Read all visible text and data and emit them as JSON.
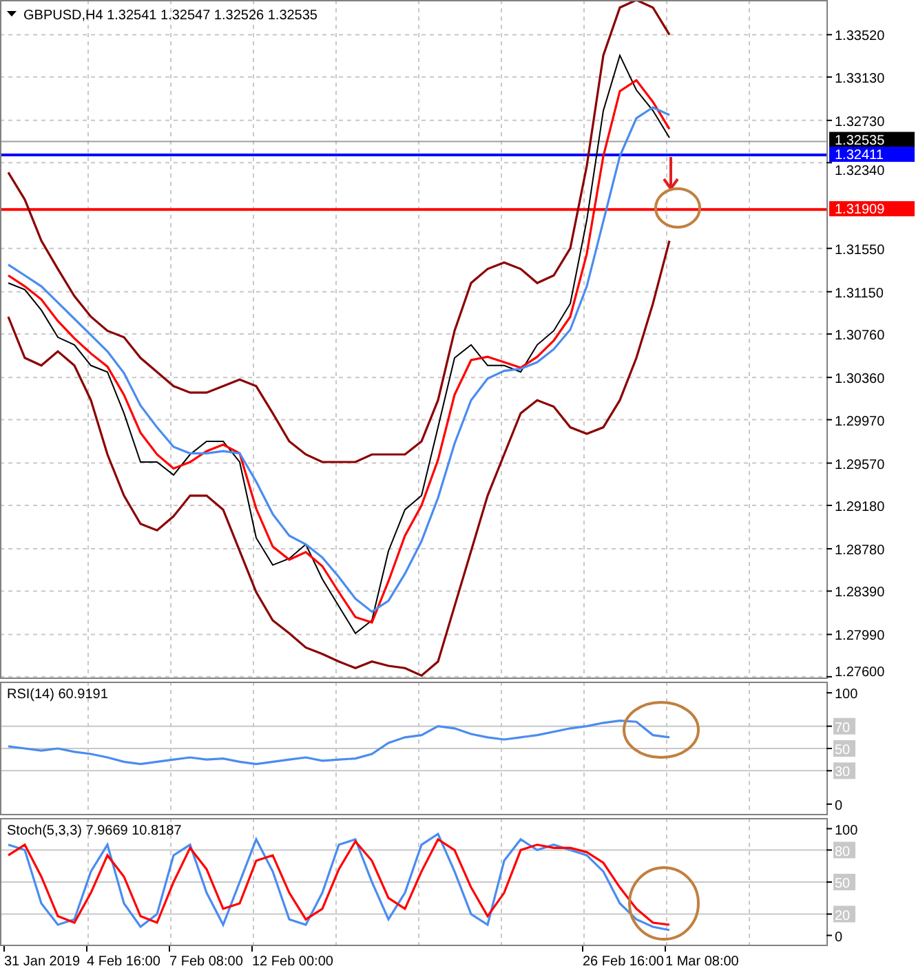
{
  "price_chart": {
    "chart_data": {
      "type": "line",
      "title": "GBPUSD,H4 1.32541 1.32547 1.32526 1.32535",
      "grid": true,
      "ylim": [
        1.2758,
        1.3384
      ],
      "yticks": [
        {
          "value": 1.3352,
          "label": "1.33520"
        },
        {
          "value": 1.3313,
          "label": "1.33130"
        },
        {
          "value": 1.3273,
          "label": "1.32730"
        },
        {
          "value": 1.3234,
          "label": "1.32340"
        },
        {
          "value": 1.3155,
          "label": "1.31550"
        },
        {
          "value": 1.3115,
          "label": "1.31150"
        },
        {
          "value": 1.3076,
          "label": "1.30760"
        },
        {
          "value": 1.3036,
          "label": "1.30360"
        },
        {
          "value": 1.2997,
          "label": "1.29970"
        },
        {
          "value": 1.2957,
          "label": "1.29570"
        },
        {
          "value": 1.2918,
          "label": "1.29180"
        },
        {
          "value": 1.2878,
          "label": "1.28780"
        },
        {
          "value": 1.2839,
          "label": "1.28390"
        },
        {
          "value": 1.2799,
          "label": "1.27990"
        },
        {
          "value": 1.276,
          "label": "1.27600"
        }
      ],
      "series": [
        {
          "color": "#000000",
          "values": [
            1.3123,
            1.3117,
            1.3098,
            1.3073,
            1.3066,
            1.3047,
            1.3041,
            1.3003,
            1.2958,
            1.2958,
            1.2946,
            1.2965,
            1.2977,
            1.2977,
            1.2958,
            1.2888,
            1.2863,
            1.2869,
            1.2882,
            1.285,
            1.2825,
            1.28,
            1.2812,
            1.2876,
            1.2914,
            1.2927,
            1.299,
            1.3054,
            1.3066,
            1.3047,
            1.3047,
            1.3041,
            1.3066,
            1.3079,
            1.3104,
            1.3181,
            1.3282,
            1.3333,
            1.3301,
            1.3282,
            1.3257
          ]
        },
        {
          "color": "#ff0000",
          "values": [
            1.313,
            1.312,
            1.3108,
            1.3088,
            1.3072,
            1.3058,
            1.3046,
            1.302,
            1.2985,
            1.2965,
            1.2952,
            1.2958,
            1.2968,
            1.2974,
            1.2966,
            1.2915,
            1.288,
            1.2868,
            1.2875,
            1.2862,
            1.2838,
            1.2815,
            1.281,
            1.2848,
            1.289,
            1.2918,
            1.296,
            1.302,
            1.3052,
            1.3055,
            1.305,
            1.3045,
            1.3055,
            1.307,
            1.3092,
            1.315,
            1.324,
            1.33,
            1.331,
            1.329,
            1.3265
          ]
        },
        {
          "color": "#4a8cf0",
          "values": [
            1.314,
            1.313,
            1.312,
            1.3105,
            1.309,
            1.3075,
            1.306,
            1.304,
            1.301,
            1.299,
            1.2972,
            1.2966,
            1.2966,
            1.2968,
            1.2966,
            1.294,
            1.291,
            1.289,
            1.2882,
            1.287,
            1.2852,
            1.2832,
            1.282,
            1.283,
            1.2855,
            1.2885,
            1.2925,
            1.2975,
            1.3015,
            1.3035,
            1.3042,
            1.3044,
            1.305,
            1.3062,
            1.308,
            1.312,
            1.318,
            1.324,
            1.3275,
            1.3285,
            1.3278
          ]
        },
        {
          "color": "#8b0000",
          "values": [
            1.3225,
            1.32,
            1.3162,
            1.3136,
            1.3111,
            1.3092,
            1.3079,
            1.3073,
            1.3054,
            1.3041,
            1.3028,
            1.3022,
            1.3022,
            1.3028,
            1.3034,
            1.3028,
            1.3003,
            1.2977,
            1.2965,
            1.2958,
            1.2958,
            1.2958,
            1.2965,
            1.2965,
            1.2965,
            1.2977,
            1.3015,
            1.3079,
            1.3123,
            1.3136,
            1.3142,
            1.3136,
            1.3123,
            1.313,
            1.3155,
            1.3231,
            1.3333,
            1.3377,
            1.3384,
            1.3377,
            1.3352
          ]
        },
        {
          "color": "#8b0000",
          "values": [
            1.3092,
            1.3054,
            1.3047,
            1.306,
            1.3047,
            1.3015,
            1.2965,
            1.2927,
            1.2901,
            1.2895,
            1.2908,
            1.2927,
            1.2927,
            1.2914,
            1.2876,
            1.2838,
            1.2812,
            1.28,
            1.2787,
            1.2781,
            1.2774,
            1.2768,
            1.2774,
            1.277,
            1.2768,
            1.2761,
            1.2774,
            1.2825,
            1.2876,
            1.2927,
            1.2965,
            1.3003,
            1.3015,
            1.3009,
            1.299,
            1.2984,
            1.299,
            1.3015,
            1.3054,
            1.3104,
            1.3162
          ]
        }
      ],
      "ref_lines": [
        {
          "axis": "y",
          "value": 1.32535,
          "label": "1.32535",
          "color": "#a0a0a0"
        },
        {
          "axis": "y",
          "value": 1.32411,
          "label": "1.32411",
          "color": "#0000ff"
        },
        {
          "axis": "y",
          "value": 1.31909,
          "label": "1.31909",
          "color": "#ff0000"
        }
      ]
    }
  },
  "rsi_panel": {
    "chart_data": {
      "type": "line",
      "title": "RSI(14) 60.9191",
      "grid": true,
      "ylim": [
        -10,
        110
      ],
      "yticks": [
        {
          "value": 100,
          "label": "100"
        },
        {
          "value": 70,
          "label": "70"
        },
        {
          "value": 50,
          "label": "50"
        },
        {
          "value": 30,
          "label": "30"
        },
        {
          "value": 0,
          "label": "0"
        }
      ],
      "series": [
        {
          "color": "#4a8cf0",
          "values": [
            52,
            50,
            48,
            50,
            47,
            45,
            42,
            38,
            36,
            38,
            40,
            42,
            40,
            41,
            38,
            36,
            38,
            40,
            42,
            39,
            40,
            41,
            45,
            55,
            60,
            62,
            70,
            68,
            63,
            60,
            58,
            60,
            62,
            65,
            68,
            70,
            73,
            75,
            74,
            62,
            60
          ]
        }
      ]
    }
  },
  "stoch_panel": {
    "chart_data": {
      "type": "line",
      "title": "Stoch(5,3,3) 7.9669 10.8187",
      "grid": true,
      "ylim": [
        -10,
        110
      ],
      "yticks": [
        {
          "value": 100,
          "label": "100"
        },
        {
          "value": 80,
          "label": "80"
        },
        {
          "value": 50,
          "label": "50"
        },
        {
          "value": 20,
          "label": "20"
        },
        {
          "value": 0,
          "label": "0"
        }
      ],
      "series": [
        {
          "color": "#4a8cf0",
          "values": [
            85,
            80,
            30,
            10,
            15,
            60,
            85,
            30,
            8,
            20,
            75,
            85,
            40,
            10,
            50,
            90,
            60,
            15,
            10,
            40,
            85,
            90,
            50,
            15,
            40,
            85,
            95,
            60,
            20,
            10,
            70,
            90,
            80,
            85,
            80,
            75,
            60,
            30,
            15,
            8,
            5
          ]
        },
        {
          "color": "#ff0000",
          "values": [
            75,
            85,
            55,
            18,
            12,
            40,
            75,
            55,
            18,
            12,
            50,
            82,
            62,
            25,
            30,
            70,
            75,
            40,
            15,
            25,
            62,
            88,
            70,
            35,
            25,
            60,
            90,
            80,
            45,
            18,
            40,
            80,
            85,
            82,
            82,
            78,
            68,
            45,
            25,
            12,
            10
          ]
        }
      ]
    }
  },
  "time_axis": {
    "labels": [
      "31 Jan 2019",
      "4 Feb 16:00",
      "7 Feb 08:00",
      "12 Feb 00:00",
      "26 Feb 16:00",
      "1 Mar 08:00"
    ]
  }
}
